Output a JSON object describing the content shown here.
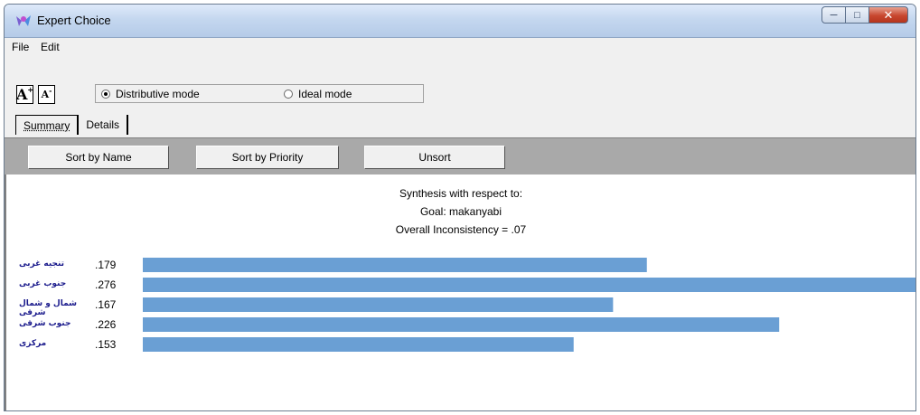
{
  "window": {
    "title": "Expert Choice"
  },
  "menu": {
    "items": [
      "File",
      "Edit"
    ]
  },
  "toolbar": {
    "font_increase_label": "A",
    "font_decrease_label": "A",
    "modes": [
      {
        "label": "Distributive mode",
        "selected": true
      },
      {
        "label": "Ideal mode",
        "selected": false
      }
    ]
  },
  "tabs": [
    {
      "label": "Summary",
      "active": true
    },
    {
      "label": "Details",
      "active": false
    }
  ],
  "sort_buttons": [
    "Sort by Name",
    "Sort by Priority",
    "Unsort"
  ],
  "synthesis": {
    "heading": "Synthesis with respect to:",
    "goal": "Goal: makanyabi",
    "inconsistency": "Overall Inconsistency = .07"
  },
  "chart_data": {
    "type": "bar",
    "orientation": "horizontal",
    "categories": [
      "تنجیه غربی",
      "جنوب غربی",
      "شمال و شمال شرقی",
      "جنوب شرقی",
      "مرکزی"
    ],
    "values": [
      0.179,
      0.276,
      0.167,
      0.226,
      0.153
    ],
    "value_labels": [
      ".179",
      ".276",
      ".167",
      ".226",
      ".153"
    ],
    "xlim": [
      0,
      0.276
    ],
    "bar_color": "#6a9fd4"
  }
}
